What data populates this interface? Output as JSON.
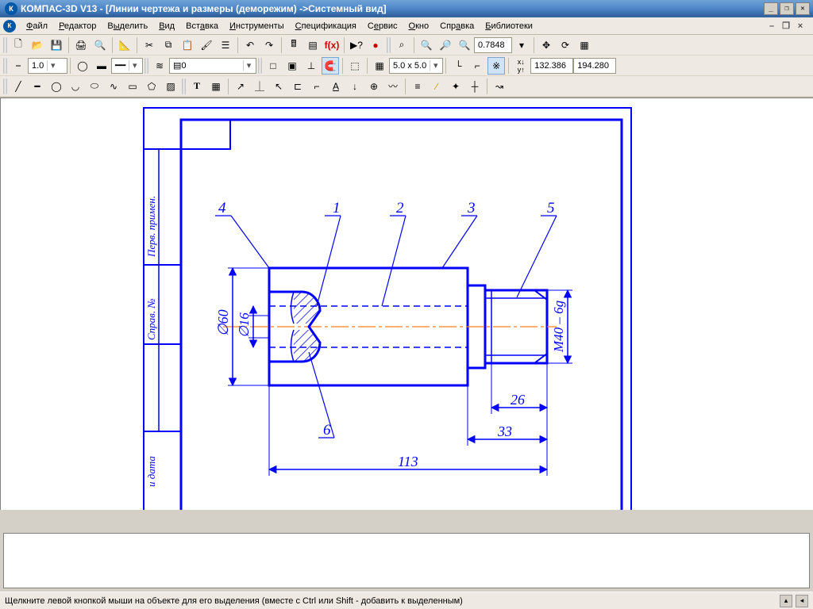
{
  "title": "КОМПАС-3D V13 - [Линии чертежа и размеры (деморежим) ->Системный вид]",
  "menu": {
    "file": "Файл",
    "editor": "Редактор",
    "select": "Выделить",
    "view": "Вид",
    "insert": "Вставка",
    "tools": "Инструменты",
    "spec": "Спецификация",
    "service": "Сервис",
    "window": "Окно",
    "help": "Справка",
    "libs": "Библиотеки"
  },
  "toolbar": {
    "lineweight": "1.0",
    "layer": "0",
    "zoom": "0.7848",
    "grid": "5.0 x 5.0",
    "coord_x": "132.386",
    "coord_y": "194.280"
  },
  "drawing": {
    "side_label1": "Перв. примен.",
    "side_label2": "Справ. №",
    "side_label3": "и дата",
    "callouts": {
      "c1": "1",
      "c2": "2",
      "c3": "3",
      "c4": "4",
      "c5": "5",
      "c6": "6"
    },
    "dims": {
      "d60": "∅60",
      "d16": "∅16",
      "m40": "M40 – 6g",
      "l113": "113",
      "l33": "33",
      "l26": "26"
    }
  },
  "status": "Щелкните левой кнопкой мыши на объекте для его выделения (вместе с Ctrl или Shift - добавить к выделенным)"
}
